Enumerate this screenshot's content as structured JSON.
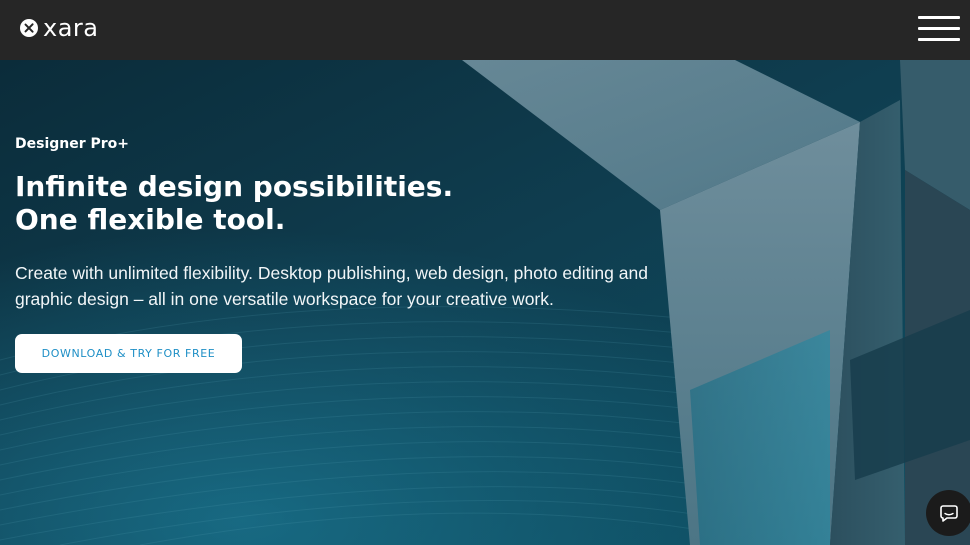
{
  "header": {
    "logo_text": "xara",
    "menu_icon": "hamburger-menu-icon"
  },
  "hero": {
    "eyebrow": "Designer Pro+",
    "headline_line1": "Infinite design possibilities.",
    "headline_line2": "One flexible tool.",
    "description": "Create with unlimited flexibility. Desktop publishing, web design, photo editing and graphic design – all in one versatile workspace for your creative work.",
    "cta_label": "DOWNLOAD & TRY FOR FREE"
  },
  "chat_widget": {
    "icon": "chat-icon"
  },
  "colors": {
    "header_bg": "#262626",
    "hero_bg": "#0c3240",
    "accent": "#1e8fc6",
    "button_bg": "#ffffff"
  }
}
